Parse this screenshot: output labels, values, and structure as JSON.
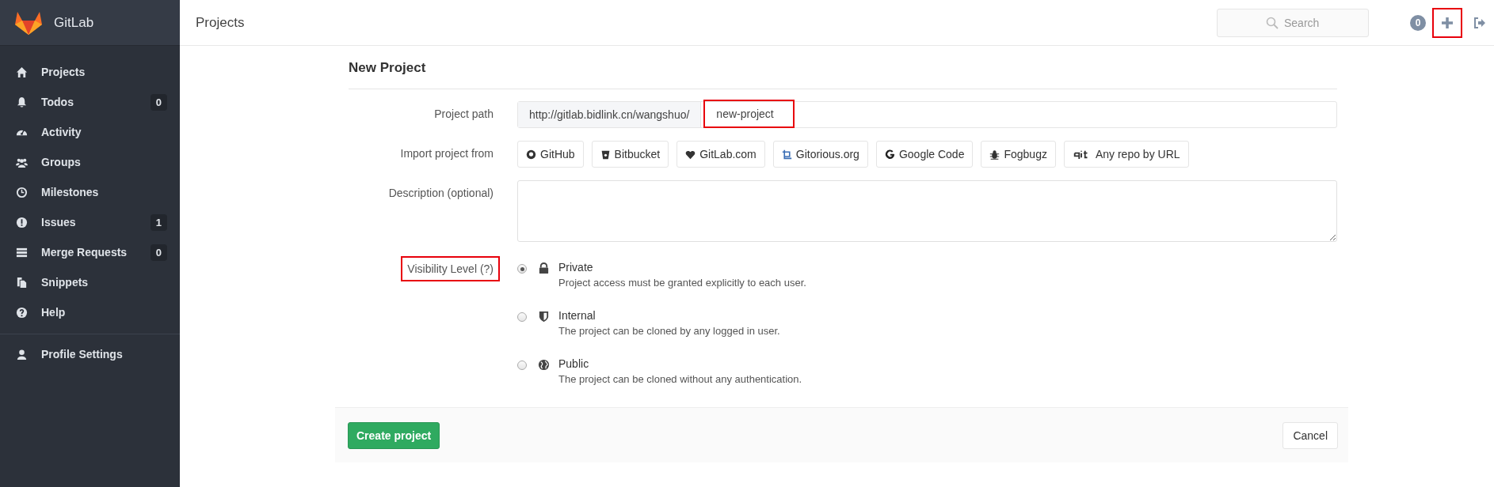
{
  "sidebar": {
    "brand": "GitLab",
    "items": [
      {
        "label": "Projects"
      },
      {
        "label": "Todos",
        "count": "0"
      },
      {
        "label": "Activity"
      },
      {
        "label": "Groups"
      },
      {
        "label": "Milestones"
      },
      {
        "label": "Issues",
        "count": "1"
      },
      {
        "label": "Merge Requests",
        "count": "0"
      },
      {
        "label": "Snippets"
      },
      {
        "label": "Help"
      }
    ],
    "footer_items": [
      {
        "label": "Profile Settings"
      }
    ]
  },
  "header": {
    "title": "Projects",
    "search": {
      "placeholder": "Search"
    },
    "todo_count": "0",
    "new_button": {
      "highlighted": true
    }
  },
  "form": {
    "title": "New Project",
    "project_path": {
      "label": "Project path",
      "prefix": "http://gitlab.bidlink.cn/wangshuo/",
      "value": "new-project",
      "highlighted": true
    },
    "import": {
      "label": "Import project from",
      "sources": [
        "GitHub",
        "Bitbucket",
        "GitLab.com",
        "Gitorious.org",
        "Google Code",
        "Fogbugz",
        "Any repo by URL"
      ]
    },
    "description": {
      "label": "Description (optional)"
    },
    "visibility": {
      "label": "Visibility Level (?)",
      "highlighted": true,
      "options": [
        {
          "title": "Private",
          "description": "Project access must be granted explicitly to each user.",
          "selected": true
        },
        {
          "title": "Internal",
          "description": "The project can be cloned by any logged in user.",
          "selected": false
        },
        {
          "title": "Public",
          "description": "The project can be cloned without any authentication.",
          "selected": false
        }
      ]
    },
    "create_button": "Create project",
    "cancel_button": "Cancel"
  }
}
